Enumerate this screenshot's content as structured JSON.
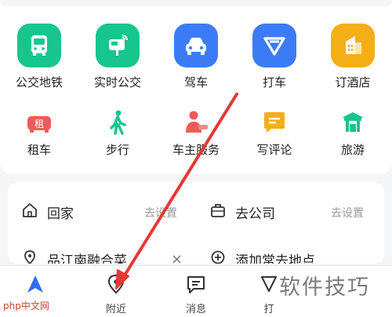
{
  "services_row1": [
    {
      "label": "公交地铁",
      "icon": "bus-icon",
      "color": "#17c68d"
    },
    {
      "label": "实时公交",
      "icon": "bus-stop-icon",
      "color": "#17c68d"
    },
    {
      "label": "驾车",
      "icon": "car-icon",
      "color": "#3b7cf6"
    },
    {
      "label": "打车",
      "icon": "taxi-icon",
      "color": "#3b7cf6"
    },
    {
      "label": "订酒店",
      "icon": "hotel-icon",
      "color": "#f4ae16"
    }
  ],
  "services_row2": [
    {
      "label": "租车",
      "icon": "rent-car-icon",
      "color": "#ee5b5b"
    },
    {
      "label": "步行",
      "icon": "walk-icon",
      "color": "#17c68d"
    },
    {
      "label": "车主服务",
      "icon": "car-owner-icon",
      "color": "#ee5b5b"
    },
    {
      "label": "写评论",
      "icon": "comment-icon",
      "color": "#f4ae16"
    },
    {
      "label": "旅游",
      "icon": "travel-icon",
      "color": "#17c68d"
    }
  ],
  "rent_glyph": "租",
  "addresses": {
    "home": {
      "label": "回家",
      "action": "去设置"
    },
    "company": {
      "label": "去公司",
      "action": "去设置"
    },
    "recent": {
      "label": "品江南融合菜…",
      "close": "×"
    },
    "add": {
      "label": "添加常去地点"
    }
  },
  "bottom_nav": [
    {
      "label": "",
      "icon": "navigation-icon"
    },
    {
      "label": "附近",
      "icon": "location-pin-icon"
    },
    {
      "label": "消息",
      "icon": "message-icon"
    },
    {
      "label": "打",
      "icon": "taxi-tab-icon"
    }
  ],
  "watermark": "软件技巧",
  "site_mark": "php中文网",
  "colors": {
    "green": "#17c68d",
    "blue": "#3b7cf6",
    "orange": "#f4ae16",
    "red": "#ee5b5b",
    "arrow": "#e53935",
    "nav_active": "#2f6df6"
  }
}
